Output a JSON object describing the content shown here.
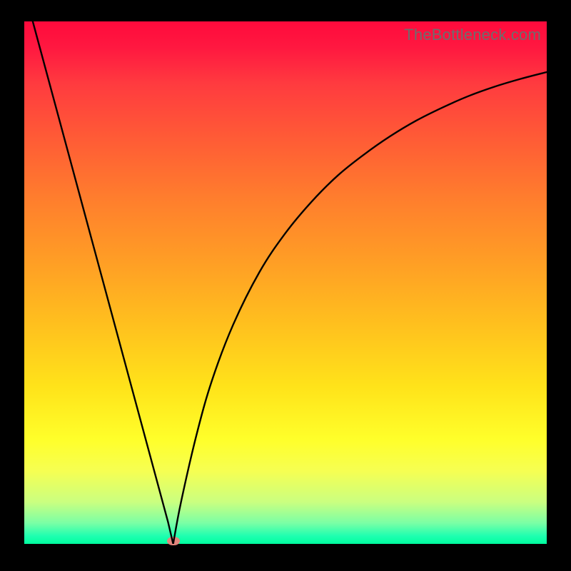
{
  "watermark": "TheBottleneck.com",
  "chart_data": {
    "type": "line",
    "title": "",
    "xlabel": "",
    "ylabel": "",
    "xlim": [
      0,
      100
    ],
    "ylim": [
      0,
      100
    ],
    "grid": false,
    "series": [
      {
        "name": "left-branch",
        "x": [
          0,
          5,
          10,
          15,
          20,
          25,
          27.5,
          28.5
        ],
        "values": [
          106,
          87.5,
          69,
          50.5,
          32,
          13.5,
          4.25,
          0
        ]
      },
      {
        "name": "right-branch",
        "x": [
          28.5,
          30,
          33,
          36,
          40,
          45,
          50,
          55,
          60,
          65,
          70,
          75,
          80,
          85,
          90,
          95,
          100
        ],
        "values": [
          0,
          8,
          21,
          31.5,
          42,
          52,
          59.5,
          65.5,
          70.5,
          74.5,
          78,
          81,
          83.5,
          85.7,
          87.5,
          89,
          90.3
        ]
      }
    ],
    "marker": {
      "x": 28.5,
      "y": 0,
      "color": "#e2857c"
    },
    "colors": {
      "curve": "#000000",
      "gradient_top": "#ff0a3c",
      "gradient_bottom": "#00ff9f"
    }
  }
}
